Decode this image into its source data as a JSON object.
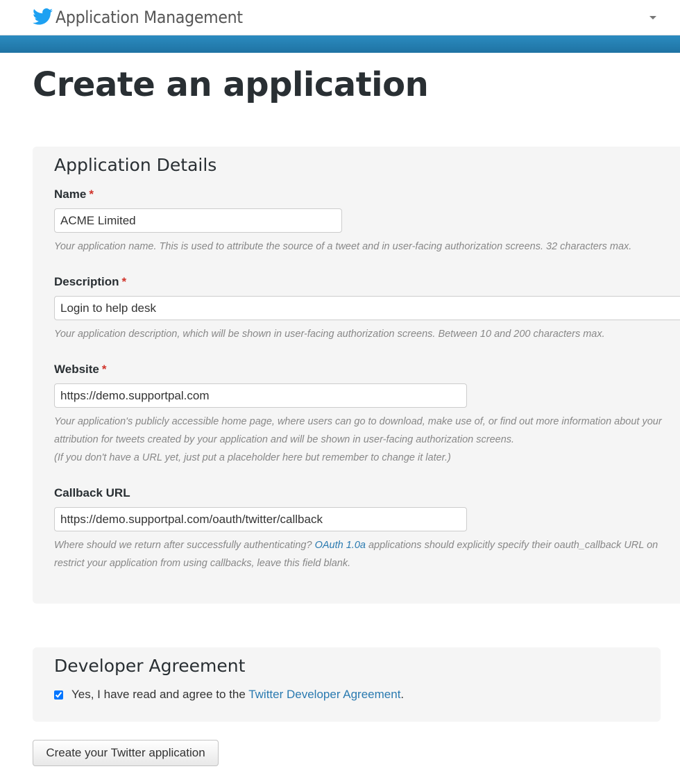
{
  "header": {
    "brand": "Application Management",
    "brand_icon": "twitter-bird-icon",
    "menu_icon": "caret-down-icon",
    "accent_color": "#1da1f2",
    "bar_color": "#2281b8"
  },
  "page": {
    "title": "Create an application"
  },
  "details": {
    "title": "Application Details",
    "required_marker": "*",
    "name": {
      "label": "Name",
      "value": "ACME Limited",
      "help": "Your application name. This is used to attribute the source of a tweet and in user-facing authorization screens. 32 characters max."
    },
    "description": {
      "label": "Description",
      "value": "Login to help desk",
      "help": "Your application description, which will be shown in user-facing authorization screens. Between 10 and 200 characters max."
    },
    "website": {
      "label": "Website",
      "value": "https://demo.supportpal.com",
      "help_line1": "Your application's publicly accessible home page, where users can go to download, make use of, or find out more information about your",
      "help_line2": "attribution for tweets created by your application and will be shown in user-facing authorization screens.",
      "help_line3": "(If you don't have a URL yet, just put a placeholder here but remember to change it later.)"
    },
    "callback": {
      "label": "Callback URL",
      "value": "https://demo.supportpal.com/oauth/twitter/callback",
      "help_prefix": "Where should we return after successfully authenticating? ",
      "help_link": "OAuth 1.0a",
      "help_suffix": " applications should explicitly specify their oauth_callback URL on",
      "help_line2": "restrict your application from using callbacks, leave this field blank."
    }
  },
  "agreement": {
    "title": "Developer Agreement",
    "checked": true,
    "text_prefix": "Yes, I have read and agree to the ",
    "link_text": "Twitter Developer Agreement",
    "text_suffix": "."
  },
  "submit": {
    "label": "Create your Twitter application"
  }
}
